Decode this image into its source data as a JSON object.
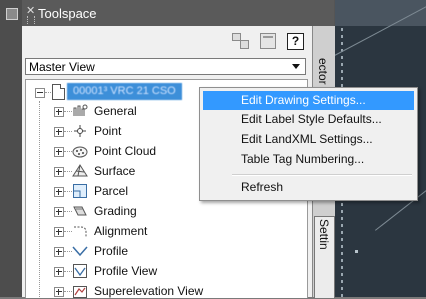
{
  "toolspace": {
    "title": "Toolspace",
    "view_selector": {
      "selected": "Master View"
    },
    "tree": {
      "root_label": "00001³ VRC 21 CSO",
      "items": [
        {
          "label": "General",
          "icon": "general-icon"
        },
        {
          "label": "Point",
          "icon": "point-icon"
        },
        {
          "label": "Point Cloud",
          "icon": "point-cloud-icon"
        },
        {
          "label": "Surface",
          "icon": "surface-icon"
        },
        {
          "label": "Parcel",
          "icon": "parcel-icon"
        },
        {
          "label": "Grading",
          "icon": "grading-icon"
        },
        {
          "label": "Alignment",
          "icon": "alignment-icon"
        },
        {
          "label": "Profile",
          "icon": "profile-icon"
        },
        {
          "label": "Profile View",
          "icon": "profile-view-icon"
        },
        {
          "label": "Superelevation View",
          "icon": "superelevation-view-icon"
        }
      ]
    },
    "tabs": {
      "prospector": "ector",
      "settings": "Settin"
    }
  },
  "context_menu": {
    "items": [
      {
        "label": "Edit Drawing Settings...",
        "highlighted": true
      },
      {
        "label": "Edit Label Style Defaults...",
        "highlighted": false
      },
      {
        "label": "Edit LandXML Settings...",
        "highlighted": false
      },
      {
        "label": "Table Tag Numbering...",
        "highlighted": false
      },
      {
        "label": "Refresh",
        "highlighted": false
      }
    ]
  },
  "colors": {
    "highlight": "#3399ff",
    "selection": "#3d8fd9",
    "panel_bg": "#f0f0f0",
    "title_bg": "#5a5a5a"
  }
}
